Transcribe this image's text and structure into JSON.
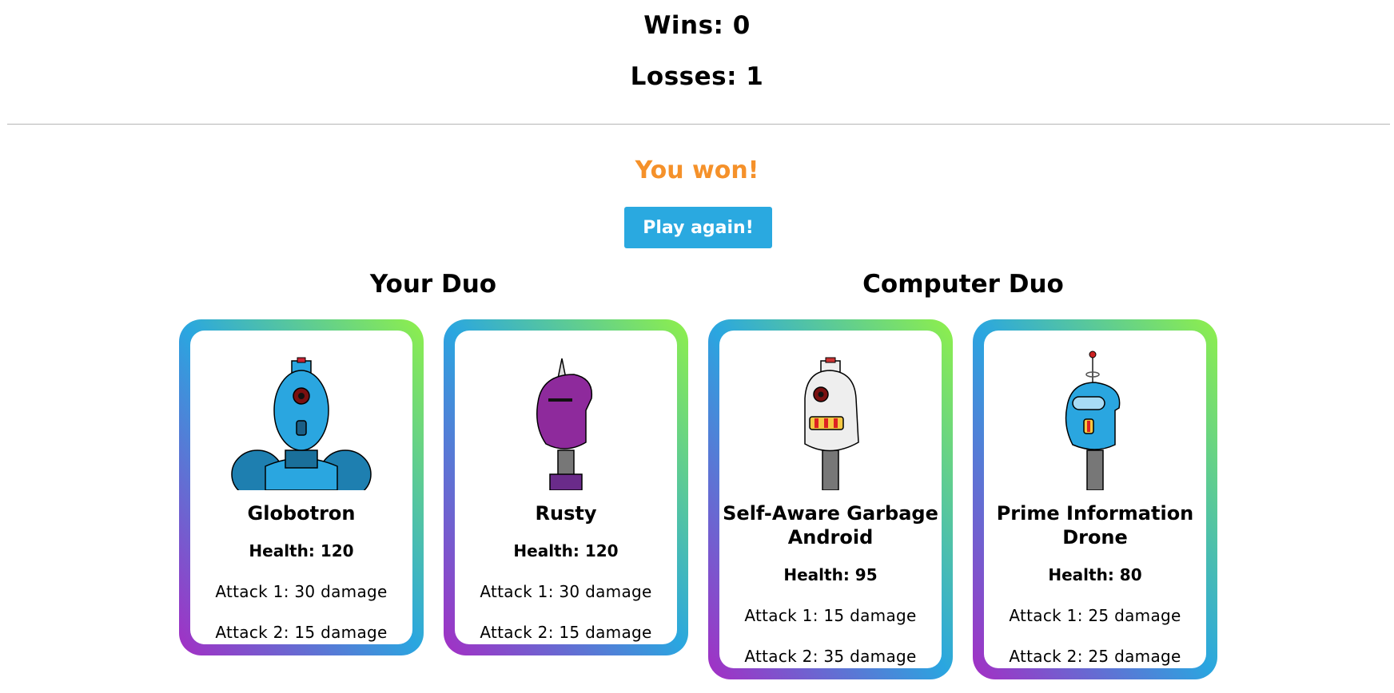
{
  "score": {
    "wins": "Wins: 0",
    "losses": "Losses: 1"
  },
  "result": {
    "message": "You won!",
    "play_again_label": "Play again!"
  },
  "your_duo": {
    "title": "Your Duo",
    "robots": [
      {
        "name": "Globotron",
        "health": "Health: 120",
        "attack1": "Attack 1: 30 damage",
        "attack2": "Attack 2: 15 damage",
        "icon": "globotron-robot-icon"
      },
      {
        "name": "Rusty",
        "health": "Health: 120",
        "attack1": "Attack 1: 30 damage",
        "attack2": "Attack 2: 15 damage",
        "icon": "rusty-robot-icon"
      }
    ]
  },
  "computer_duo": {
    "title": "Computer Duo",
    "robots": [
      {
        "name": "Self-Aware Garbage Android",
        "health": "Health: 95",
        "attack1": "Attack 1: 15 damage",
        "attack2": "Attack 2: 35 damage",
        "icon": "garbage-android-robot-icon"
      },
      {
        "name": "Prime Information Drone",
        "health": "Health: 80",
        "attack1": "Attack 1: 25 damage",
        "attack2": "Attack 2: 25 damage",
        "icon": "information-drone-robot-icon"
      }
    ]
  },
  "colors": {
    "accent": "#2aa9e0",
    "result": "#f5912a",
    "gradient": [
      "#a42ec4",
      "#2aa6e0",
      "#8ff04a"
    ]
  }
}
